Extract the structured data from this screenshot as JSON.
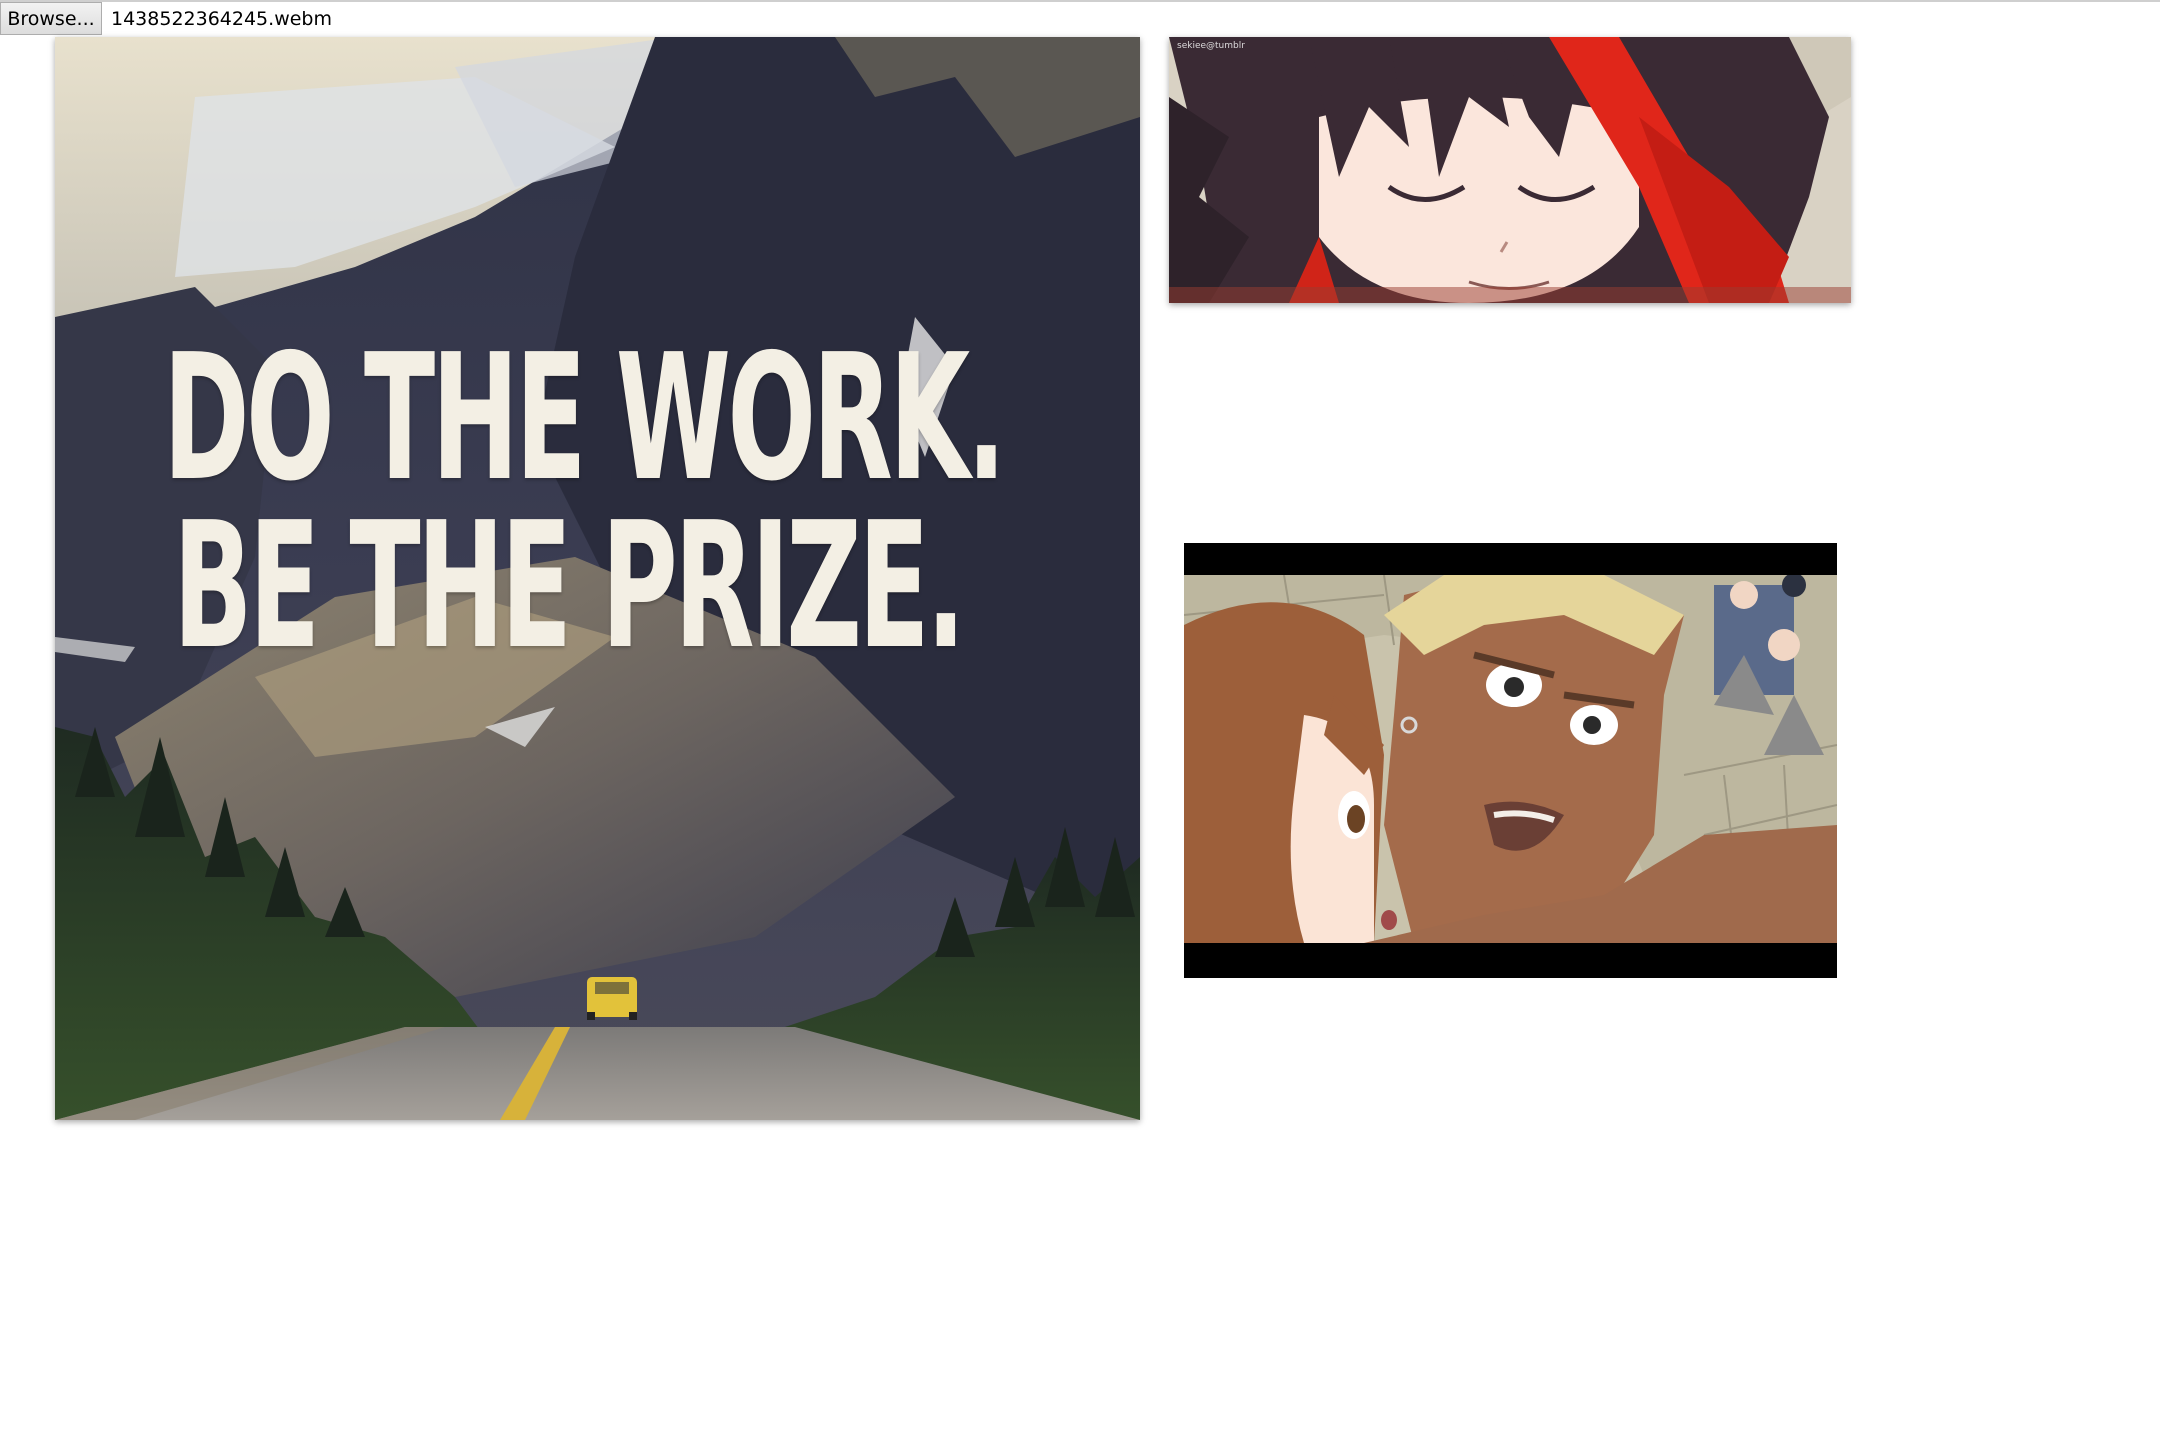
{
  "file_input": {
    "button_label": "Browse...",
    "file_name": "1438522364245.webm"
  },
  "poster": {
    "line1": "DO THE WORK.",
    "line2": "BE THE PRIZE."
  },
  "frame1": {
    "watermark": "sekiee@tumblr"
  },
  "colors": {
    "poster_text": "#f3efe4",
    "page_background": "#ffffff",
    "letterbox": "#000000"
  }
}
